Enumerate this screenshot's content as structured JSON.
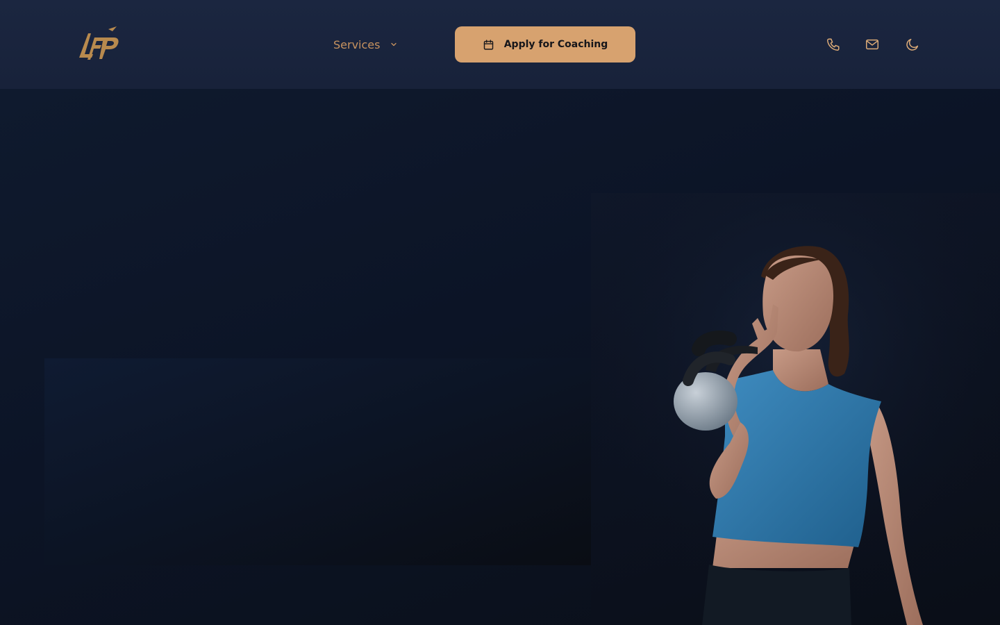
{
  "header": {
    "logo_icon": "lfp-logo",
    "nav": {
      "services_label": "Services",
      "chevron_icon": "chevron-down-icon"
    },
    "cta": {
      "label": "Apply for Coaching",
      "icon": "calendar-icon"
    },
    "actions": [
      {
        "icon": "phone-icon"
      },
      {
        "icon": "mail-icon"
      },
      {
        "icon": "moon-icon"
      }
    ]
  },
  "hero": {
    "image": "woman-holding-kettlebell-photo"
  },
  "colors": {
    "accent": "#d7a26f",
    "nav_text": "#c8935f",
    "header_bg": "#1b2640",
    "page_bg": "#0c1220",
    "icon_stroke": "#e0ad78"
  }
}
